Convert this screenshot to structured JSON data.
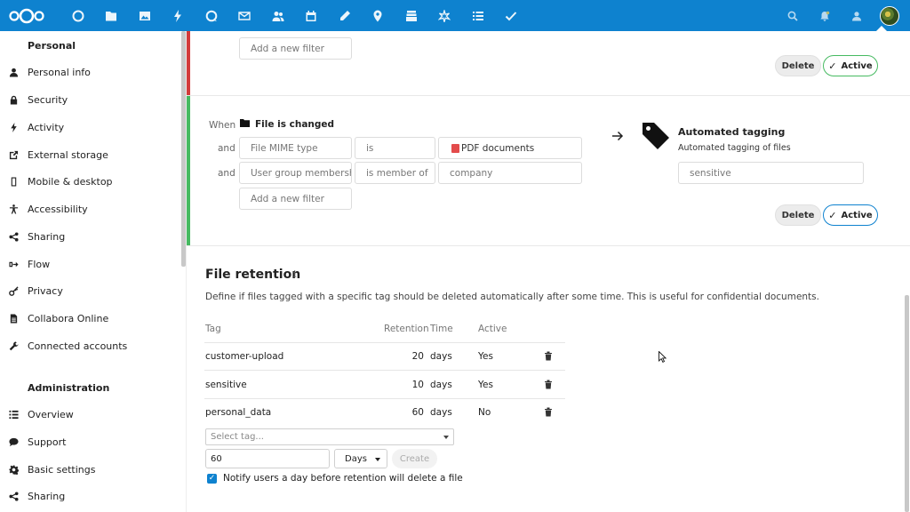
{
  "colors": {
    "header_bg": "#0e82cf",
    "accent": "#0e82cf",
    "rule_red": "#d33b3b",
    "rule_green": "#46ba61"
  },
  "header": {
    "apps": [
      "dashboard-icon",
      "files-icon",
      "photos-icon",
      "activity-icon",
      "talk-icon",
      "mail-icon",
      "contacts-icon",
      "calendar-icon",
      "notes-icon",
      "maps-icon",
      "deck-icon",
      "social-icon",
      "tasks-icon",
      "checkmark-icon"
    ],
    "right": [
      "search-icon",
      "notifications-icon",
      "contacts-menu-icon"
    ]
  },
  "sidebar": {
    "personal_heading": "Personal",
    "personal_items": [
      {
        "label": "Personal info",
        "icon": "user-icon"
      },
      {
        "label": "Security",
        "icon": "lock-icon"
      },
      {
        "label": "Activity",
        "icon": "activity-icon"
      },
      {
        "label": "External storage",
        "icon": "external-link-icon"
      },
      {
        "label": "Mobile & desktop",
        "icon": "phone-icon"
      },
      {
        "label": "Accessibility",
        "icon": "accessibility-icon"
      },
      {
        "label": "Sharing",
        "icon": "share-icon"
      },
      {
        "label": "Flow",
        "icon": "flow-icon"
      },
      {
        "label": "Privacy",
        "icon": "key-icon"
      },
      {
        "label": "Collabora Online",
        "icon": "document-icon"
      },
      {
        "label": "Connected accounts",
        "icon": "wrench-icon"
      }
    ],
    "admin_heading": "Administration",
    "admin_items": [
      {
        "label": "Overview",
        "icon": "list-icon"
      },
      {
        "label": "Support",
        "icon": "chat-icon"
      },
      {
        "label": "Basic settings",
        "icon": "gear-icon"
      },
      {
        "label": "Sharing",
        "icon": "share-icon"
      }
    ]
  },
  "rule1": {
    "add_filter_placeholder": "Add a new filter",
    "delete_label": "Delete",
    "active_label": "Active"
  },
  "rule2": {
    "when_label": "When",
    "event_label": "File is changed",
    "and_label": "and",
    "filters": [
      {
        "field": "File MIME type",
        "op": "is",
        "value": "PDF documents"
      },
      {
        "field": "User group membership",
        "op": "is member of",
        "value": "company"
      }
    ],
    "add_filter_placeholder": "Add a new filter",
    "operation_title": "Automated tagging",
    "operation_desc": "Automated tagging of files",
    "tag_value": "sensitive",
    "delete_label": "Delete",
    "active_label": "Active"
  },
  "retention": {
    "title": "File retention",
    "info_icon": "i",
    "description": "Define if files tagged with a specific tag should be deleted automatically after some time. This is useful for confidential documents.",
    "headers": {
      "tag": "Tag",
      "retention": "Retention",
      "time": "Time",
      "active": "Active"
    },
    "rows": [
      {
        "tag": "customer-upload",
        "retention": "20",
        "time": "days",
        "active": "Yes"
      },
      {
        "tag": "sensitive",
        "retention": "10",
        "time": "days",
        "active": "Yes"
      },
      {
        "tag": "personal_data",
        "retention": "60",
        "time": "days",
        "active": "No"
      }
    ],
    "select_tag_placeholder": "Select tag...",
    "amount_value": "60",
    "unit_value": "Days",
    "create_label": "Create",
    "notify_label": "Notify users a day before retention will delete a file"
  }
}
